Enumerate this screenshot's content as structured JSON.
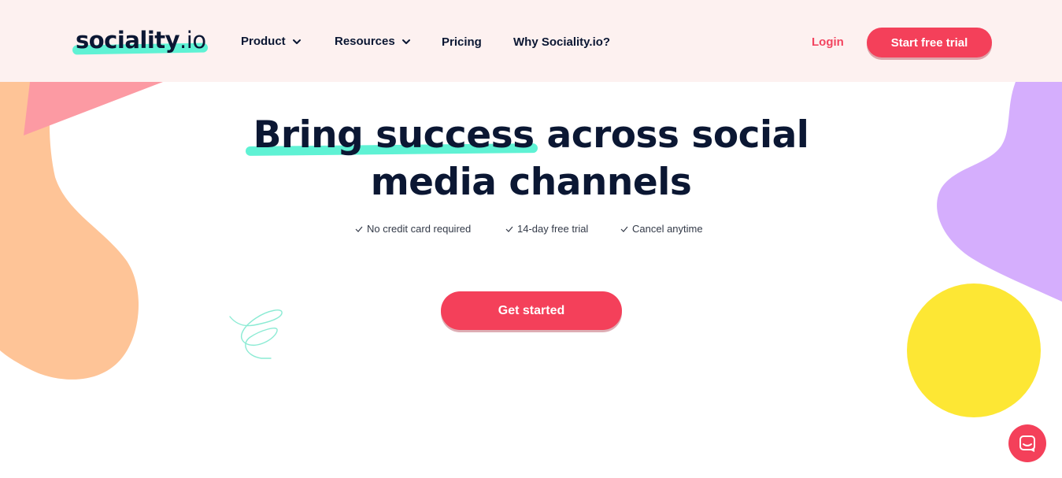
{
  "brand": {
    "logo_main": "sociality",
    "logo_tld": ".io"
  },
  "nav": {
    "items": [
      {
        "label": "Product",
        "has_dropdown": true
      },
      {
        "label": "Resources",
        "has_dropdown": true
      },
      {
        "label": "Pricing",
        "has_dropdown": false
      },
      {
        "label": "Why Sociality.io?",
        "has_dropdown": false
      }
    ],
    "login_label": "Login",
    "trial_label": "Start free trial"
  },
  "hero": {
    "title_highlight": "Bring success",
    "title_rest_line1": " across social",
    "title_line2": "media channels",
    "benefits": [
      "No credit card required",
      "14-day free trial",
      "Cancel anytime"
    ],
    "cta_label": "Get started"
  },
  "chat": {
    "icon": "chat-icon"
  },
  "colors": {
    "accent": "#f4405a",
    "highlight": "#5ff2d4",
    "header_bg": "#fdf1f0",
    "text_dark": "#0b1733",
    "peach": "#fec497",
    "pink": "#fc9aa3",
    "purple": "#d5aefd",
    "yellow": "#fde734"
  }
}
